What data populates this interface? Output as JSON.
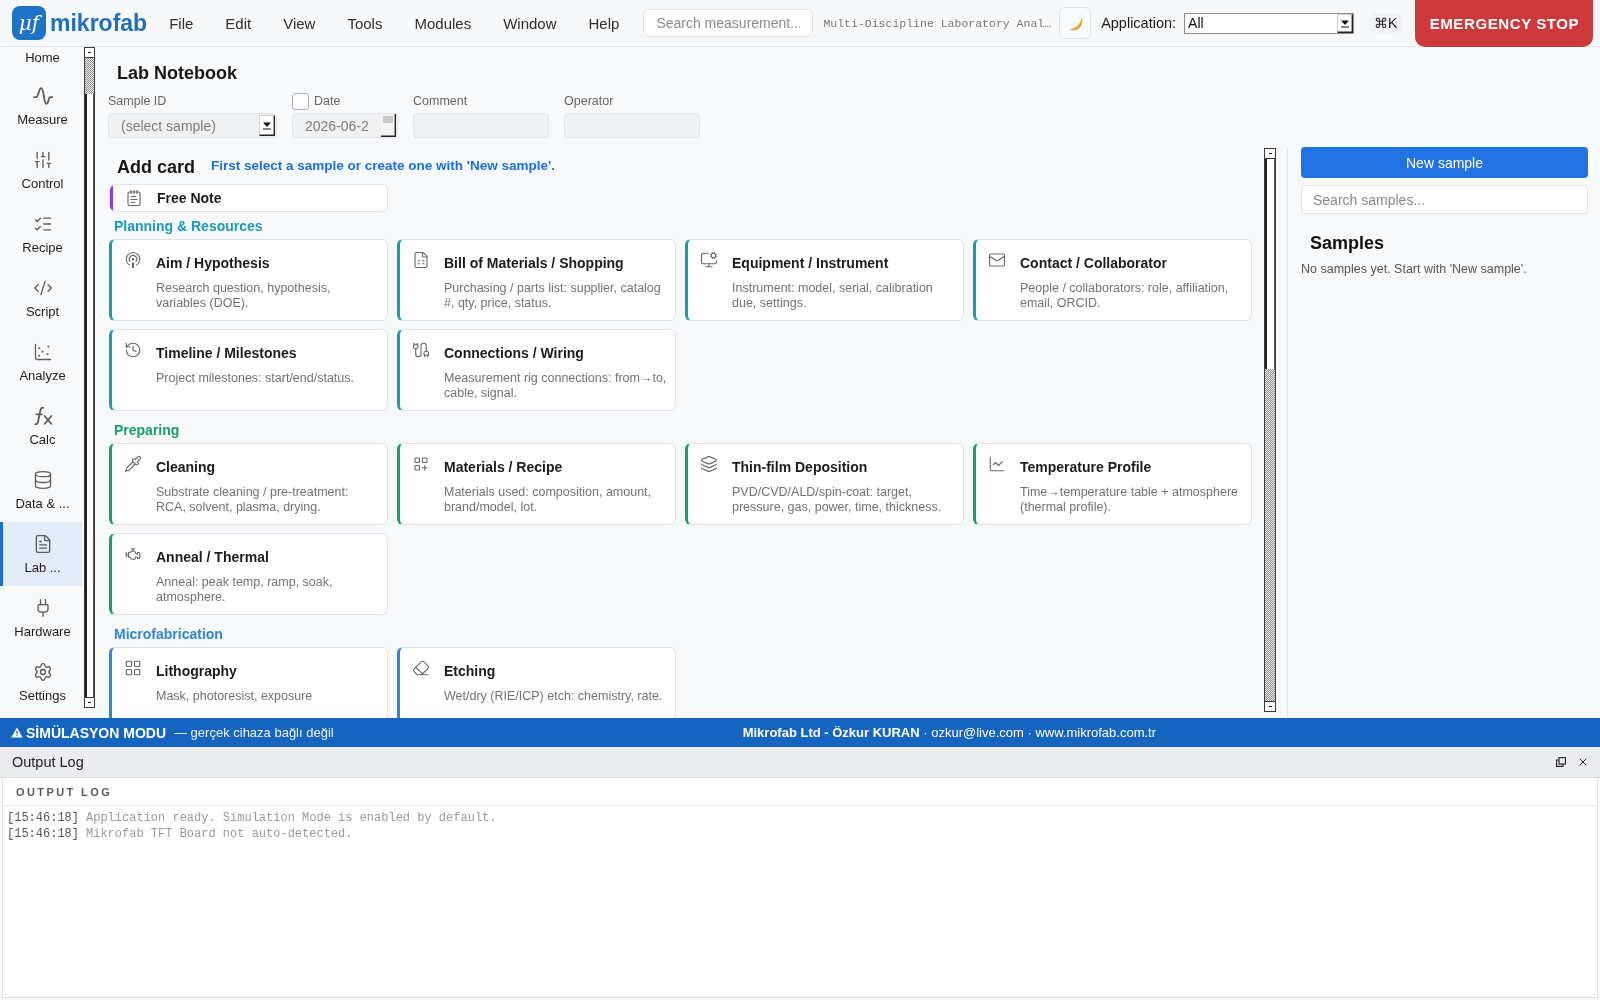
{
  "app_bar": {
    "logo": {
      "mark": "μf",
      "name": "mikrofab"
    },
    "menu": [
      "File",
      "Edit",
      "View",
      "Tools",
      "Modules",
      "Window",
      "Help"
    ],
    "search": {
      "placeholder": "Search measurement..."
    },
    "subtitle": "Multi-Discipline Laboratory Anal…",
    "application": {
      "label": "Application:",
      "value": "All"
    },
    "shortcut": "⌘K",
    "emergency_button": "EMERGENCY STOP"
  },
  "sidebar": {
    "items": [
      {
        "label": "Home",
        "selected": false
      },
      {
        "label": "Measure",
        "selected": false
      },
      {
        "label": "Control",
        "selected": false
      },
      {
        "label": "Recipe",
        "selected": false
      },
      {
        "label": "Script",
        "selected": false
      },
      {
        "label": "Analyze",
        "selected": false
      },
      {
        "label": "Calc",
        "selected": false
      },
      {
        "label": "Data & ...",
        "selected": false
      },
      {
        "label": "Lab ...",
        "selected": true
      },
      {
        "label": "Hardware",
        "selected": false
      },
      {
        "label": "Settings",
        "selected": false
      }
    ]
  },
  "notebook": {
    "title": "Lab Notebook",
    "form": {
      "fields": [
        {
          "kind": "select",
          "label": "Sample ID",
          "value": "(select sample)",
          "disabled": true
        },
        {
          "kind": "date",
          "label": "Date",
          "checkbox": {
            "checked": false
          },
          "value": "2026-06-2",
          "disabled": true
        },
        {
          "kind": "text",
          "label": "Comment",
          "disabled": true
        },
        {
          "kind": "text",
          "label": "Operator",
          "disabled": true
        }
      ]
    },
    "add_card": {
      "title": "Add card",
      "hint": "First select a sample or create one with 'New sample'."
    },
    "card_groups": [
      {
        "kind": "strip",
        "color": "#8b3ff0",
        "cards": [
          {
            "title": "Free Note"
          }
        ]
      },
      {
        "kind": "grid",
        "heading": "Planning & Resources",
        "color": "#1b9bb7",
        "cards": [
          {
            "title": "Aim / Hypothesis",
            "description": "Research question, hypothesis, variables (DOE)."
          },
          {
            "title": "Bill of Materials / Shopping",
            "description": "Purchasing / parts list: supplier, catalog #, qty, price, status."
          },
          {
            "title": "Equipment / Instrument",
            "description": "Instrument: model, serial, calibration due, settings."
          },
          {
            "title": "Contact / Collaborator",
            "description": "People / collaborators: role, affiliation, email, ORCID."
          },
          {
            "title": "Timeline / Milestones",
            "description": "Project milestones: start/end/status."
          },
          {
            "title": "Connections / Wiring",
            "description": "Measurement rig connections: from→to, cable, signal."
          }
        ]
      },
      {
        "kind": "grid",
        "heading": "Preparing",
        "color": "#17a06b",
        "cards": [
          {
            "title": "Cleaning",
            "description": "Substrate cleaning / pre-treatment: RCA, solvent, plasma, drying."
          },
          {
            "title": "Materials / Recipe",
            "description": "Materials used: composition, amount, brand/model, lot."
          },
          {
            "title": "Thin-film Deposition",
            "description": "PVD/CVD/ALD/spin-coat: target, pressure, gas, power, time, thickness."
          },
          {
            "title": "Temperature Profile",
            "description": "Time→temperature table + atmosphere (thermal profile)."
          },
          {
            "title": "Anneal / Thermal",
            "description": "Anneal: peak temp, ramp, soak, atmosphere."
          }
        ]
      },
      {
        "kind": "grid",
        "heading": "Microfabrication",
        "color": "#2f86d8",
        "cards": [
          {
            "title": "Lithography",
            "description": "Mask, photoresist, exposure"
          },
          {
            "title": "Etching",
            "description": "Wet/dry (RIE/ICP) etch: chemistry, rate."
          }
        ]
      }
    ]
  },
  "samples_panel": {
    "button": "New sample",
    "search": {
      "placeholder": "Search samples..."
    },
    "title": "Samples",
    "empty_text": "No samples yet. Start with 'New sample'."
  },
  "status_bar": {
    "mode": "SİMÜLASYON MODU",
    "mode_note": "— gerçek cihaza bağlı değil",
    "credits": "**Mikrofab Ltd - Özkur KURAN** · ozkur@live.com · www.mikrofab.com.tr"
  },
  "output_log": {
    "title": "Output Log",
    "header": "OUTPUT LOG",
    "lines": [
      {
        "time": "[15:46:18]",
        "message": "Application ready. Simulation Mode is enabled by default."
      },
      {
        "time": "[15:46:18]",
        "message": "Mikrofab TFT Board not auto-detected."
      }
    ]
  }
}
